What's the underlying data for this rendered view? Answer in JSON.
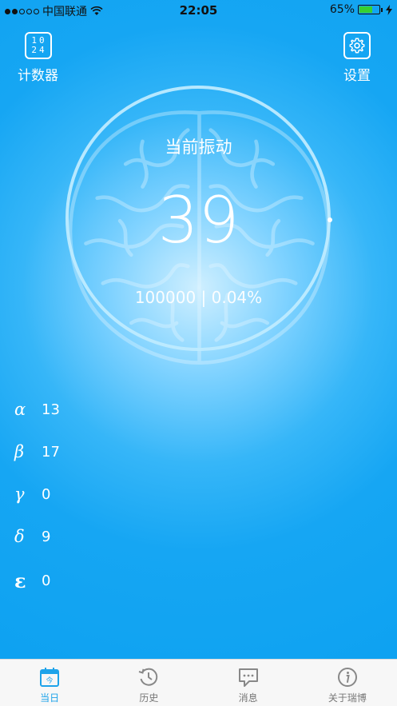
{
  "status_bar": {
    "carrier": "中国联通",
    "time": "22:05",
    "battery_percent": "65%",
    "battery_level": 0.65,
    "signal_icon": "signal-dots-icon",
    "wifi_icon": "wifi-icon",
    "charging_icon": "bolt-icon"
  },
  "header": {
    "counter": {
      "icon_text_top": "10",
      "icon_text_bottom": "24",
      "label": "计数器"
    },
    "settings": {
      "label": "设置",
      "icon": "gear-icon"
    }
  },
  "gauge": {
    "title": "当前振动",
    "value": "39",
    "subtitle": "100000 | 0.04%"
  },
  "waves": [
    {
      "symbol": "α",
      "value": "13"
    },
    {
      "symbol": "β",
      "value": "17"
    },
    {
      "symbol": "γ",
      "value": "0"
    },
    {
      "symbol": "δ",
      "value": "9"
    },
    {
      "symbol": "ε",
      "value": "0"
    }
  ],
  "tabs": [
    {
      "label": "当日",
      "icon": "calendar-today-icon",
      "active": true
    },
    {
      "label": "历史",
      "icon": "history-icon",
      "active": false
    },
    {
      "label": "消息",
      "icon": "message-icon",
      "active": false
    },
    {
      "label": "关于瑞博",
      "icon": "info-icon",
      "active": false
    }
  ],
  "colors": {
    "background": "#0ea2f1",
    "tab_active": "#1da3ea",
    "tab_inactive": "#777777"
  }
}
